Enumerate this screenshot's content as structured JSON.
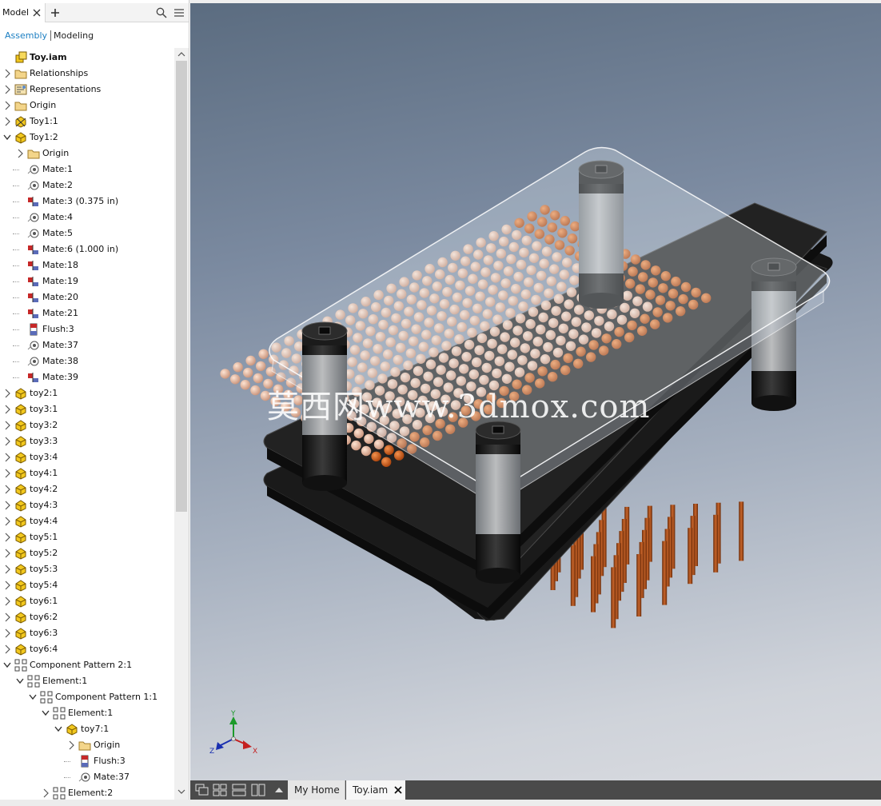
{
  "panel": {
    "tab_label": "Model",
    "modes": {
      "assembly": "Assembly",
      "modeling": "Modeling"
    }
  },
  "tree": [
    {
      "label": "Toy.iam",
      "icon": "assembly-icon",
      "level": 0,
      "expander": "none",
      "bold": true
    },
    {
      "label": "Relationships",
      "icon": "folder-icon",
      "level": 0,
      "expander": "collapsed"
    },
    {
      "label": "Representations",
      "icon": "representations-icon",
      "level": 0,
      "expander": "collapsed"
    },
    {
      "label": "Origin",
      "icon": "folder-icon",
      "level": 0,
      "expander": "collapsed"
    },
    {
      "label": "Toy1:1",
      "icon": "grounded-part-icon",
      "level": 0,
      "expander": "collapsed"
    },
    {
      "label": "Toy1:2",
      "icon": "part-icon",
      "level": 0,
      "expander": "expanded"
    },
    {
      "label": "Origin",
      "icon": "folder-icon",
      "level": 1,
      "expander": "collapsed"
    },
    {
      "label": "Mate:1",
      "icon": "mate-icon",
      "level": 1,
      "expander": "none"
    },
    {
      "label": "Mate:2",
      "icon": "mate-icon",
      "level": 1,
      "expander": "none"
    },
    {
      "label": "Mate:3 (0.375 in)",
      "icon": "mate-offset-icon",
      "level": 1,
      "expander": "none"
    },
    {
      "label": "Mate:4",
      "icon": "mate-icon",
      "level": 1,
      "expander": "none"
    },
    {
      "label": "Mate:5",
      "icon": "mate-icon",
      "level": 1,
      "expander": "none"
    },
    {
      "label": "Mate:6 (1.000 in)",
      "icon": "mate-offset-icon",
      "level": 1,
      "expander": "none"
    },
    {
      "label": "Mate:18",
      "icon": "mate-offset-icon",
      "level": 1,
      "expander": "none"
    },
    {
      "label": "Mate:19",
      "icon": "mate-offset-icon",
      "level": 1,
      "expander": "none"
    },
    {
      "label": "Mate:20",
      "icon": "mate-offset-icon",
      "level": 1,
      "expander": "none"
    },
    {
      "label": "Mate:21",
      "icon": "mate-offset-icon",
      "level": 1,
      "expander": "none"
    },
    {
      "label": "Flush:3",
      "icon": "flush-icon",
      "level": 1,
      "expander": "none"
    },
    {
      "label": "Mate:37",
      "icon": "mate-icon",
      "level": 1,
      "expander": "none"
    },
    {
      "label": "Mate:38",
      "icon": "mate-icon",
      "level": 1,
      "expander": "none"
    },
    {
      "label": "Mate:39",
      "icon": "mate-offset-icon",
      "level": 1,
      "expander": "none"
    },
    {
      "label": "toy2:1",
      "icon": "part-icon",
      "level": 0,
      "expander": "collapsed"
    },
    {
      "label": "toy3:1",
      "icon": "part-icon",
      "level": 0,
      "expander": "collapsed"
    },
    {
      "label": "toy3:2",
      "icon": "part-icon",
      "level": 0,
      "expander": "collapsed"
    },
    {
      "label": "toy3:3",
      "icon": "part-icon",
      "level": 0,
      "expander": "collapsed"
    },
    {
      "label": "toy3:4",
      "icon": "part-icon",
      "level": 0,
      "expander": "collapsed"
    },
    {
      "label": "toy4:1",
      "icon": "part-icon",
      "level": 0,
      "expander": "collapsed"
    },
    {
      "label": "toy4:2",
      "icon": "part-icon",
      "level": 0,
      "expander": "collapsed"
    },
    {
      "label": "toy4:3",
      "icon": "part-icon",
      "level": 0,
      "expander": "collapsed"
    },
    {
      "label": "toy4:4",
      "icon": "part-icon",
      "level": 0,
      "expander": "collapsed"
    },
    {
      "label": "toy5:1",
      "icon": "part-icon",
      "level": 0,
      "expander": "collapsed"
    },
    {
      "label": "toy5:2",
      "icon": "part-icon",
      "level": 0,
      "expander": "collapsed"
    },
    {
      "label": "toy5:3",
      "icon": "part-icon",
      "level": 0,
      "expander": "collapsed"
    },
    {
      "label": "toy5:4",
      "icon": "part-icon",
      "level": 0,
      "expander": "collapsed"
    },
    {
      "label": "toy6:1",
      "icon": "part-icon",
      "level": 0,
      "expander": "collapsed"
    },
    {
      "label": "toy6:2",
      "icon": "part-icon",
      "level": 0,
      "expander": "collapsed"
    },
    {
      "label": "toy6:3",
      "icon": "part-icon",
      "level": 0,
      "expander": "collapsed"
    },
    {
      "label": "toy6:4",
      "icon": "part-icon",
      "level": 0,
      "expander": "collapsed"
    },
    {
      "label": "Component Pattern 2:1",
      "icon": "pattern-icon",
      "level": 0,
      "expander": "expanded"
    },
    {
      "label": "Element:1",
      "icon": "pattern-icon",
      "level": 1,
      "expander": "expanded"
    },
    {
      "label": "Component Pattern 1:1",
      "icon": "pattern-icon",
      "level": 2,
      "expander": "expanded"
    },
    {
      "label": "Element:1",
      "icon": "pattern-icon",
      "level": 3,
      "expander": "expanded"
    },
    {
      "label": "toy7:1",
      "icon": "part-icon",
      "level": 4,
      "expander": "expanded"
    },
    {
      "label": "Origin",
      "icon": "folder-icon",
      "level": 5,
      "expander": "collapsed"
    },
    {
      "label": "Flush:3",
      "icon": "flush-icon",
      "level": 5,
      "expander": "none"
    },
    {
      "label": "Mate:37",
      "icon": "mate-icon",
      "level": 5,
      "expander": "none"
    },
    {
      "label": "Element:2",
      "icon": "pattern-icon",
      "level": 3,
      "expander": "collapsed"
    }
  ],
  "viewport": {
    "watermark": "莫西网www.3dmox.com",
    "triad": {
      "y": "Y",
      "z": "Z",
      "x": "X"
    }
  },
  "document_tabs": [
    {
      "label": "My Home",
      "active": false
    },
    {
      "label": "Toy.iam",
      "active": true
    }
  ],
  "colors": {
    "accent": "#1b7ec2",
    "part_yellow": "#f2c81e",
    "bead_light": "#e8b69a",
    "bead_orange": "#d25f14",
    "pin_copper": "#a8501c",
    "plate_dark": "#1e1e1e"
  }
}
